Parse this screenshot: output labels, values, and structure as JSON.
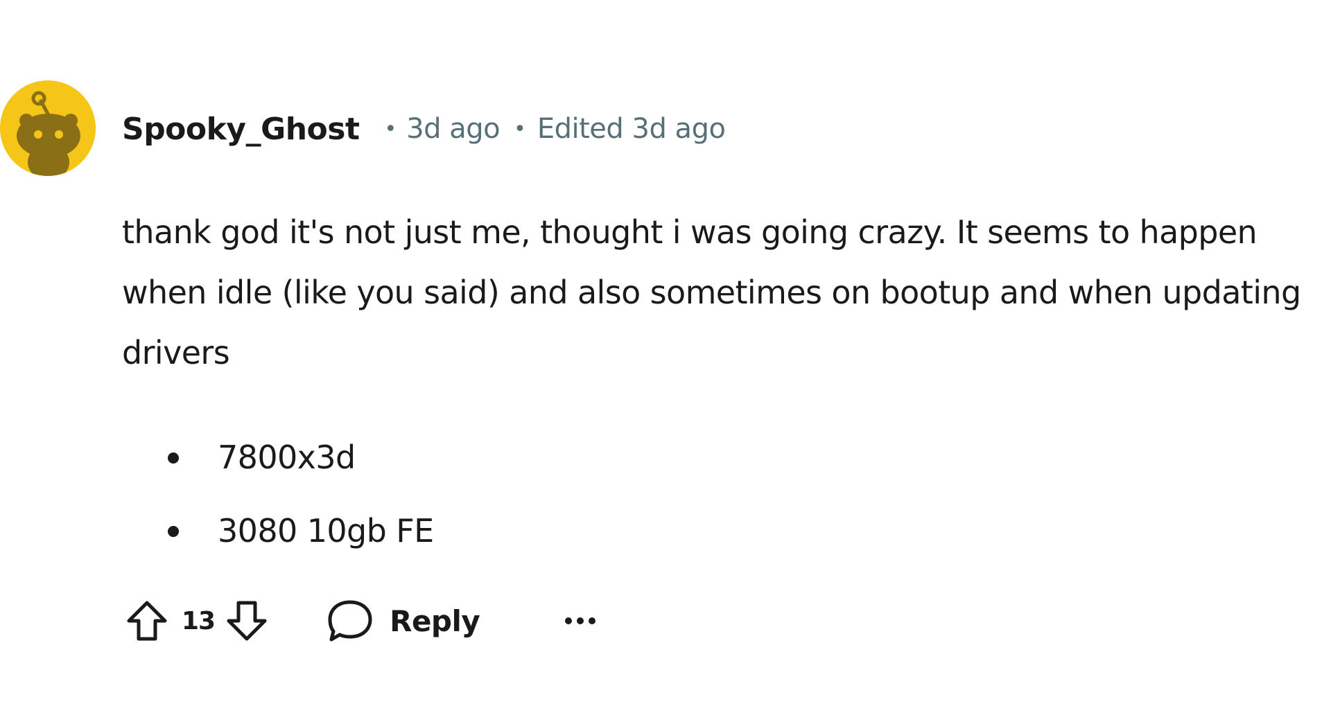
{
  "comment": {
    "author": "Spooky_Ghost",
    "separator": "•",
    "posted": "3d ago",
    "edited": "Edited 3d ago",
    "body": "thank god it's not just me, thought i was going crazy. It seems to happen when idle (like you said) and also sometimes on bootup and when updating drivers",
    "specs": [
      "7800x3d",
      "3080 10gb FE"
    ],
    "avatar_color": "#f5c518",
    "avatar_icon": "snoo-avatar-icon"
  },
  "actions": {
    "upvote_icon": "upvote-arrow-icon",
    "score": "13",
    "downvote_icon": "downvote-arrow-icon",
    "reply_icon": "speech-bubble-icon",
    "reply_label": "Reply",
    "more_icon": "ellipsis-icon"
  }
}
